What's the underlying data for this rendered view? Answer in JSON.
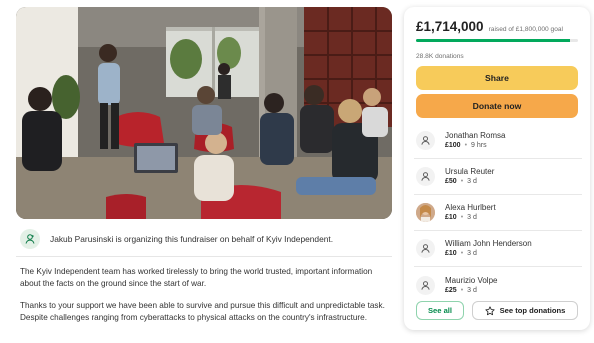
{
  "campaign": {
    "organizer_text": "Jakub Parusinski is organizing this fundraiser on behalf of Kyiv Independent.",
    "story": [
      "The Kyiv Independent team has worked tirelessly to bring the world trusted, important information about the facts on the ground since the start of war.",
      "Thanks to your support we have been able to survive and pursue this difficult and unpredictable task. Despite challenges ranging from cyberattacks to physical attacks on the country's infrastructure."
    ]
  },
  "progress": {
    "raised": "£1,714,000",
    "goal_text": "raised of £1,800,000 goal",
    "fraction": 0.952,
    "donations": "28.8K donations"
  },
  "buttons": {
    "share": "Share",
    "donate": "Donate now",
    "see_all": "See all",
    "see_top": "See top donations"
  },
  "donors": [
    {
      "name": "Jonathan Romsa",
      "amount": "£100",
      "time": "9 hrs",
      "avatar": "user-icon"
    },
    {
      "name": "Ursula Reuter",
      "amount": "£50",
      "time": "3 d",
      "avatar": "user-icon"
    },
    {
      "name": "Alexa Hurlbert",
      "amount": "£10",
      "time": "3 d",
      "avatar": "photo"
    },
    {
      "name": "William John Henderson",
      "amount": "£10",
      "time": "3 d",
      "avatar": "user-icon"
    },
    {
      "name": "Maurizio Volpe",
      "amount": "£25",
      "time": "3 d",
      "avatar": "user-icon"
    }
  ],
  "colors": {
    "accent_green": "#02a95c",
    "share_yellow": "#f7cb5a",
    "donate_orange": "#f6a84a"
  }
}
